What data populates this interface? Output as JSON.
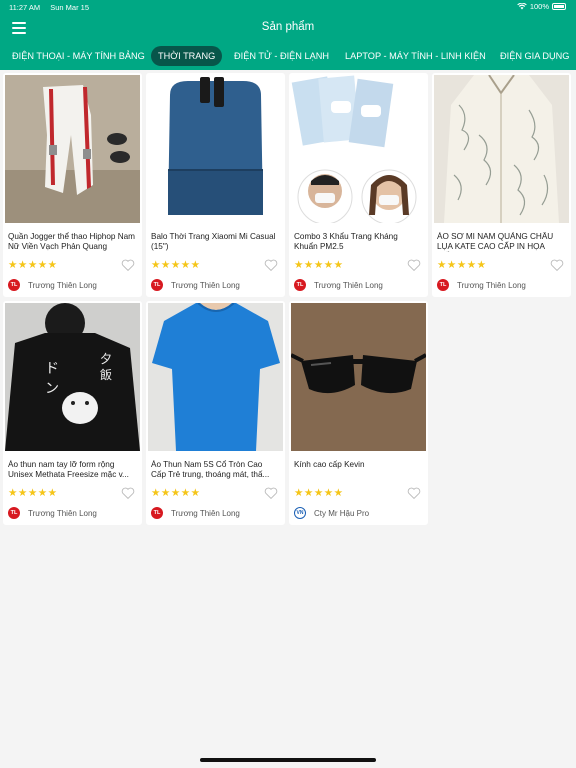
{
  "status_bar": {
    "time": "11:27 AM",
    "date": "Sun Mar 15",
    "battery": "100%"
  },
  "header": {
    "title": "Sản phẩm",
    "menu_icon": "menu-icon"
  },
  "tabs": [
    {
      "label": "ĐIỆN THOẠI - MÁY TÍNH BẢNG",
      "active": false
    },
    {
      "label": "THỜI TRANG",
      "active": true
    },
    {
      "label": "ĐIỆN TỬ - ĐIỆN LẠNH",
      "active": false
    },
    {
      "label": "LAPTOP - MÁY TÍNH - LINH KIỆN",
      "active": false
    },
    {
      "label": "ĐIỆN GIA DỤNG",
      "active": false
    }
  ],
  "products": [
    {
      "name": "Quần Jogger thể thao Hiphop Nam Nữ Viền Vạch Phản Quang",
      "rating": 5,
      "shop": "Trương Thiên Long",
      "shop_logo": "TL",
      "image": "white jogger pants with red stripe"
    },
    {
      "name": "Balo Thời Trang Xiaomi Mi Casual (15\")",
      "rating": 5,
      "shop": "Trương Thiên Long",
      "shop_logo": "TL",
      "image": "blue backpack"
    },
    {
      "name": "Combo 3 Khẩu Trang Kháng Khuẩn PM2.5",
      "rating": 5,
      "shop": "Trương Thiên Long",
      "shop_logo": "TL",
      "image": "face masks packs"
    },
    {
      "name": "ÁO SƠ MI NAM QUẢNG CHÂU LỤA KATE CAO CẤP IN HỌA TIẾ...",
      "rating": 5,
      "shop": "Trương Thiên Long",
      "shop_logo": "TL",
      "image": "patterned shirt"
    },
    {
      "name": "Áo thun nam tay lỡ form rộng Unisex Methata Freesize mặc v...",
      "rating": 5,
      "shop": "Trương Thiên Long",
      "shop_logo": "TL",
      "image": "black tshirt"
    },
    {
      "name": "Áo Thun Nam 5S Cổ Tròn Cao Cấp Trẻ trung, thoáng mát, thấ...",
      "rating": 5,
      "shop": "Trương Thiên Long",
      "shop_logo": "TL",
      "image": "blue tshirt"
    },
    {
      "name": "Kính cao cấp Kevin",
      "rating": 5,
      "shop": "Cty Mr Hậu Pro",
      "shop_logo": "VN",
      "image": "sunglasses"
    }
  ],
  "icons": {
    "star": "star-icon",
    "heart": "heart-icon",
    "wifi": "wifi-icon",
    "battery": "battery-icon"
  },
  "colors": {
    "accent": "#00a884",
    "active_tab": "#07564a",
    "star": "#f5c518"
  }
}
